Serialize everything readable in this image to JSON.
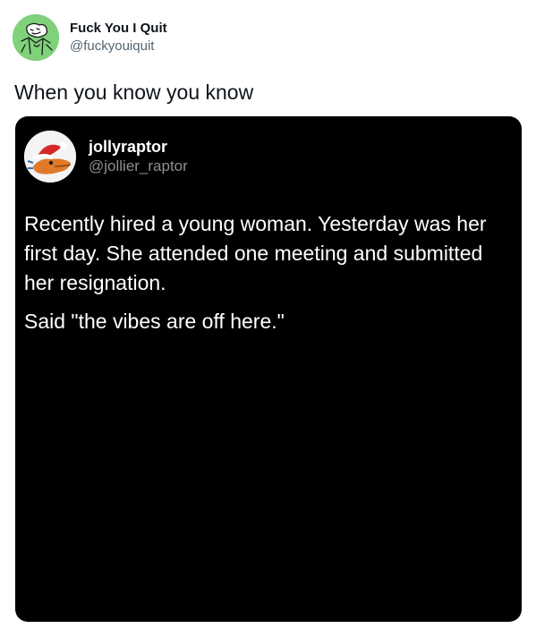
{
  "author": {
    "display_name": "Fuck You I Quit",
    "handle": "@fuckyouiquit",
    "avatar_icon": "illustrated-avatar-icon",
    "avatar_color": "#7fd27a"
  },
  "tweet": {
    "text": "When you know you know"
  },
  "media": {
    "background_color": "#000000",
    "quoted_post": {
      "display_name": "jollyraptor",
      "handle": "@jollier_raptor",
      "avatar_icon": "raptor-santa-hat-avatar-icon",
      "paragraphs": [
        "Recently hired a young woman. Yesterday was her first day. She attended one meeting and submitted her resignation.",
        "Said \"the vibes are off here.\""
      ]
    }
  }
}
